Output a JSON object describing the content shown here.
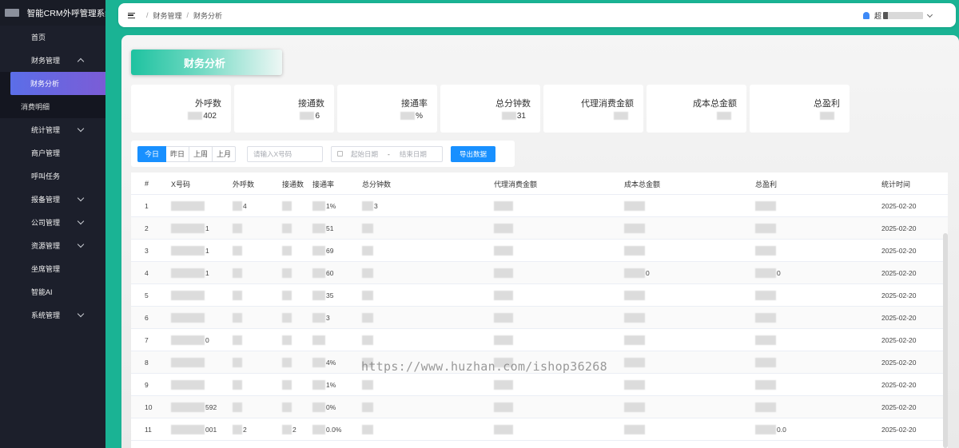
{
  "app": {
    "title": "智能CRM外呼管理系统"
  },
  "sidebar": {
    "items": [
      {
        "label": "首页",
        "name": "sidebar-item-home",
        "chevron": "none"
      },
      {
        "label": "财务管理",
        "name": "sidebar-item-finance",
        "chevron": "up"
      },
      {
        "label": "统计管理",
        "name": "sidebar-item-stats",
        "chevron": "down"
      },
      {
        "label": "商户管理",
        "name": "sidebar-item-merchant",
        "chevron": "none"
      },
      {
        "label": "呼叫任务",
        "name": "sidebar-item-call-task",
        "chevron": "none"
      },
      {
        "label": "报备管理",
        "name": "sidebar-item-report",
        "chevron": "down"
      },
      {
        "label": "公司管理",
        "name": "sidebar-item-company",
        "chevron": "down"
      },
      {
        "label": "资源管理",
        "name": "sidebar-item-resource",
        "chevron": "down"
      },
      {
        "label": "坐席管理",
        "name": "sidebar-item-seat",
        "chevron": "none"
      },
      {
        "label": "智能AI",
        "name": "sidebar-item-ai",
        "chevron": "none"
      },
      {
        "label": "系统管理",
        "name": "sidebar-item-system",
        "chevron": "down"
      }
    ],
    "finance_sub": [
      {
        "label": "财务分析",
        "active": true
      },
      {
        "label": "消费明细",
        "active": false
      }
    ]
  },
  "header": {
    "breadcrumb": [
      "财务管理",
      "财务分析"
    ],
    "user_initial": "超"
  },
  "page": {
    "title": "财务分析"
  },
  "stats": [
    {
      "label": "外呼数",
      "value": "402"
    },
    {
      "label": "接通数",
      "value": "6"
    },
    {
      "label": "接通率",
      "value": "%"
    },
    {
      "label": "总分钟数",
      "value": "31"
    },
    {
      "label": "代理消费金额",
      "value": ""
    },
    {
      "label": "成本总金额",
      "value": ""
    },
    {
      "label": "总盈利",
      "value": ""
    }
  ],
  "filters": {
    "ranges": [
      "今日",
      "昨日",
      "上周",
      "上月"
    ],
    "active_range": "今日",
    "number_placeholder": "请输入X号码",
    "start_placeholder": "起始日期",
    "date_separator": "-",
    "end_placeholder": "结束日期",
    "export_label": "导出数据"
  },
  "table": {
    "columns": [
      "#",
      "X号码",
      "外呼数",
      "接通数",
      "接通率",
      "总分钟数",
      "代理消费金额",
      "成本总金额",
      "总盈利",
      "统计时间"
    ],
    "rows": [
      {
        "idx": "1",
        "x": "",
        "calls": "4",
        "conn": "",
        "rate": "1%",
        "mins": "3",
        "agent": "",
        "cost": "",
        "profit": "",
        "date": "2025-02-20"
      },
      {
        "idx": "2",
        "x": "1",
        "calls": "",
        "conn": "",
        "rate": "51",
        "mins": "",
        "agent": "",
        "cost": "",
        "profit": "",
        "date": "2025-02-20"
      },
      {
        "idx": "3",
        "x": "1",
        "calls": "",
        "conn": "",
        "rate": "69",
        "mins": "",
        "agent": "",
        "cost": "",
        "profit": "",
        "date": "2025-02-20"
      },
      {
        "idx": "4",
        "x": "1",
        "calls": "",
        "conn": "",
        "rate": "60",
        "mins": "",
        "agent": "",
        "cost": "0",
        "profit": "0",
        "date": "2025-02-20"
      },
      {
        "idx": "5",
        "x": "",
        "calls": "",
        "conn": "",
        "rate": "35",
        "mins": "",
        "agent": "",
        "cost": "",
        "profit": "",
        "date": "2025-02-20"
      },
      {
        "idx": "6",
        "x": "",
        "calls": "",
        "conn": "",
        "rate": "3",
        "mins": "",
        "agent": "",
        "cost": "",
        "profit": "",
        "date": "2025-02-20"
      },
      {
        "idx": "7",
        "x": "0",
        "calls": "",
        "conn": "",
        "rate": "",
        "mins": "",
        "agent": "",
        "cost": "",
        "profit": "",
        "date": "2025-02-20"
      },
      {
        "idx": "8",
        "x": "",
        "calls": "",
        "conn": "",
        "rate": "4%",
        "mins": "",
        "agent": "",
        "cost": "",
        "profit": "",
        "date": "2025-02-20"
      },
      {
        "idx": "9",
        "x": "",
        "calls": "",
        "conn": "",
        "rate": "1%",
        "mins": "",
        "agent": "",
        "cost": "",
        "profit": "",
        "date": "2025-02-20"
      },
      {
        "idx": "10",
        "x": "592",
        "calls": "",
        "conn": "",
        "rate": "0%",
        "mins": "",
        "agent": "",
        "cost": "",
        "profit": "",
        "date": "2025-02-20"
      },
      {
        "idx": "11",
        "x": "001",
        "calls": "2",
        "conn": "2",
        "rate": "0.0%",
        "mins": "",
        "agent": "",
        "cost": "",
        "profit": "0.0",
        "date": "2025-02-20"
      }
    ]
  },
  "watermark": "https://www.huzhan.com/ishop36268",
  "colors": {
    "accent": "#1ab394",
    "primary": "#1890ff",
    "sidebar_bg": "#1c1f2b"
  }
}
